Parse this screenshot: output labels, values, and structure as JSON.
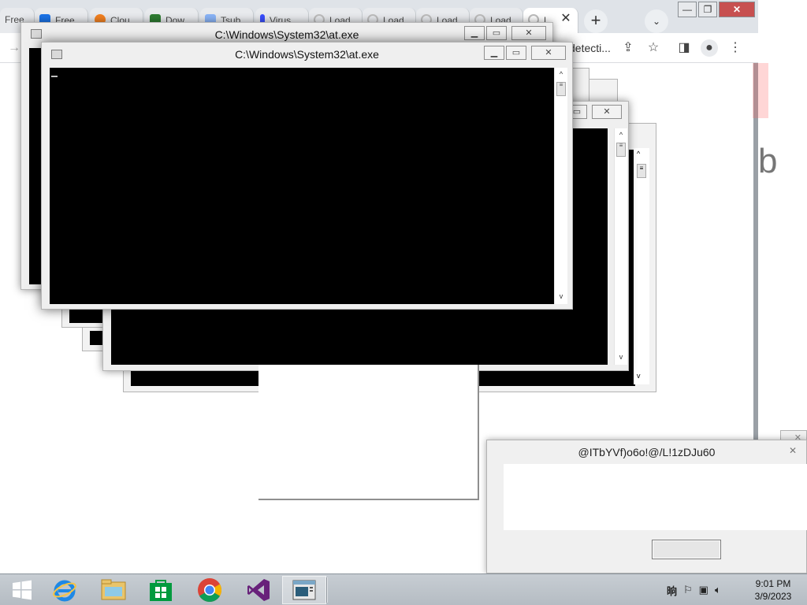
{
  "browser": {
    "tabs": [
      {
        "label": "Free",
        "color": "#9aa0a6"
      },
      {
        "label": "Free",
        "color": "#1a73e8"
      },
      {
        "label": "Clou",
        "color": "#f48120"
      },
      {
        "label": "Dow",
        "color": "#2e7d32"
      },
      {
        "label": "Tsub",
        "color": "#8ab4f8"
      },
      {
        "label": "Virus",
        "color": "#394eff"
      },
      {
        "label": "Load",
        "color": "#bdbdbd"
      },
      {
        "label": "Load",
        "color": "#bdbdbd"
      },
      {
        "label": "Load",
        "color": "#bdbdbd"
      },
      {
        "label": "Load",
        "color": "#bdbdbd"
      },
      {
        "label": "L",
        "color": "#bdbdbd"
      }
    ],
    "tab_close_glyph": "✕",
    "new_tab_glyph": "+",
    "tab_search_glyph": "⌄",
    "window_controls": {
      "minimize": "—",
      "maximize": "❐",
      "close": "✕"
    },
    "address_fragment": "detecti...",
    "toolbar_icons": [
      "share-icon",
      "star-icon",
      "sidepanel-icon",
      "profile-icon",
      "menu-icon"
    ]
  },
  "console_windows": {
    "back_title": "C:\\Windows\\System32\\at.exe",
    "front_title": "C:\\Windows\\System32\\at.exe",
    "buttons": {
      "minimize": "▁",
      "maximize": "▭",
      "close": "✕"
    },
    "scroll_up": "^",
    "scroll_down": "v",
    "thumb_glyph": "≡"
  },
  "dialog": {
    "title": "@ITbYVf)o6o!@/L!1zDJu60",
    "close_glyph": "✕",
    "button_label": ""
  },
  "taskbar": {
    "tray_ime": "晌",
    "clock_time": "9:01 PM",
    "clock_date": "3/9/2023"
  },
  "colors": {
    "taskbar": "#c0c7ce",
    "console_bg": "#000000",
    "ie_blue": "#1e88e5",
    "vs_purple": "#68217a",
    "store_green": "#009a3e"
  }
}
